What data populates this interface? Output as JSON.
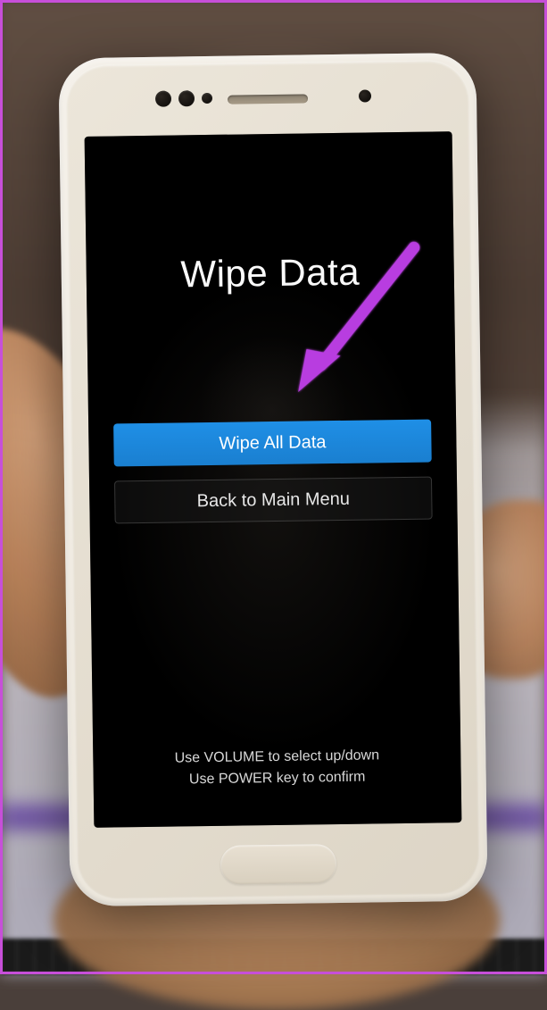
{
  "screen": {
    "title": "Wipe Data",
    "menu": [
      {
        "label": "Wipe All Data",
        "selected": true
      },
      {
        "label": "Back to Main Menu",
        "selected": false
      }
    ],
    "hint_line1": "Use VOLUME to select up/down",
    "hint_line2": "Use POWER key to confirm"
  },
  "annotation": {
    "arrow_color": "#b83ee0"
  }
}
